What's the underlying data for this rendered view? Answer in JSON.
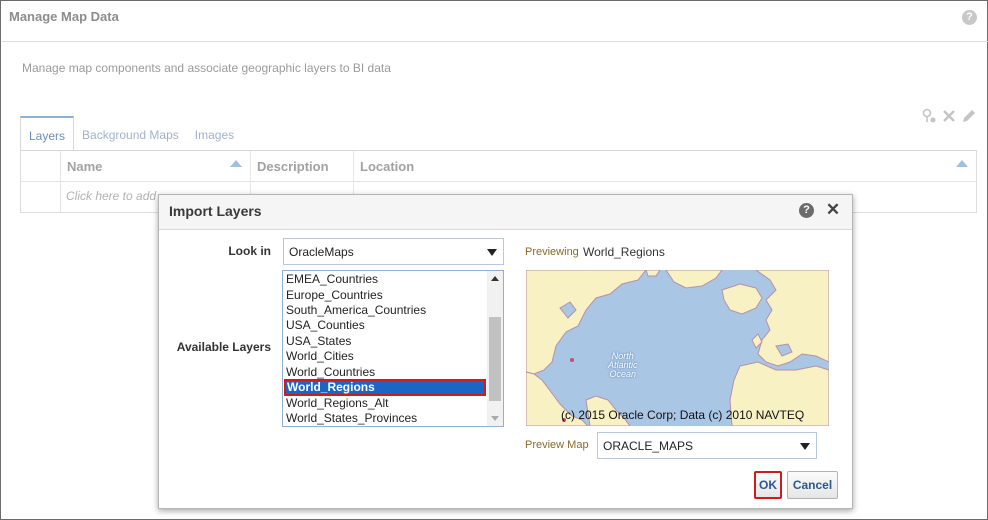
{
  "page": {
    "title": "Manage Map Data",
    "help_icon": "?",
    "description": "Manage map components and associate geographic layers to BI data"
  },
  "tabs": [
    {
      "label": "Layers",
      "active": true
    },
    {
      "label": "Background Maps",
      "active": false
    },
    {
      "label": "Images",
      "active": false
    }
  ],
  "toolbar": {
    "icons": [
      "import-layer-icon",
      "delete-icon",
      "edit-icon"
    ]
  },
  "grid": {
    "columns": [
      "Name",
      "Description",
      "Location"
    ],
    "placeholder": "Click here to add"
  },
  "dialog": {
    "title": "Import Layers",
    "help_icon": "?",
    "close_icon": "✕",
    "look_in_label": "Look in",
    "look_in_value": "OracleMaps",
    "available_layers_label": "Available Layers",
    "layers": [
      "EMEA_Countries",
      "Europe_Countries",
      "South_America_Countries",
      "USA_Counties",
      "USA_States",
      "World_Cities",
      "World_Countries",
      "World_Regions",
      "World_Regions_Alt",
      "World_States_Provinces"
    ],
    "selected_layer": "World_Regions",
    "previewing_label": "Previewing",
    "previewing_value": "World_Regions",
    "map_ocean_label": [
      "North",
      "Atlantic",
      "Ocean"
    ],
    "map_copyright": "(c) 2015 Oracle Corp; Data (c) 2010 NAVTEQ",
    "preview_map_label": "Preview Map",
    "preview_map_value": "ORACLE_MAPS",
    "ok_label": "OK",
    "cancel_label": "Cancel"
  },
  "colors": {
    "selection": "#1b66c4",
    "highlight_border": "#d11a1a",
    "ocean": "#a9c6e5",
    "land": "#f7f1c4"
  }
}
